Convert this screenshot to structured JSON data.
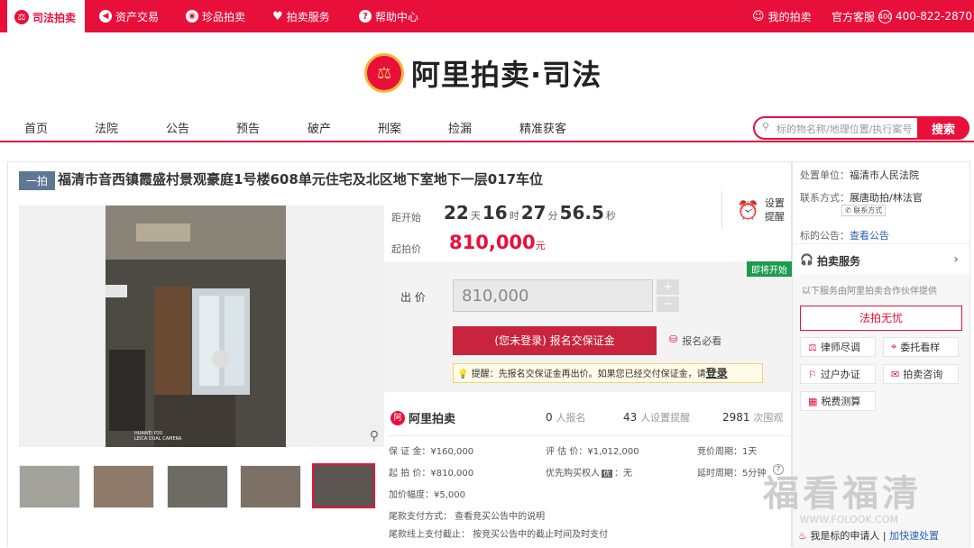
{
  "topbar": {
    "tabs": [
      {
        "label": "司法拍卖",
        "icon": "gavel-icon"
      },
      {
        "label": "资产交易",
        "icon": "asset-icon"
      },
      {
        "label": "珍品拍卖",
        "icon": "treasure-icon"
      },
      {
        "label": "拍卖服务",
        "icon": "heart-icon"
      },
      {
        "label": "帮助中心",
        "icon": "help-icon"
      }
    ],
    "my_auction": "我的拍卖",
    "customer_service": "官方客服",
    "phone": "400-822-2870"
  },
  "brand": {
    "name": "阿里拍卖·司法"
  },
  "nav": {
    "items": [
      "首页",
      "法院",
      "公告",
      "预告",
      "破产",
      "刑案",
      "捡漏",
      "精准获客"
    ]
  },
  "search": {
    "placeholder": "标的物名称/地理位置/执行案号",
    "button": "搜索"
  },
  "item": {
    "round": "一拍",
    "title": "福清市音西镇霞盛村景观豪庭1号楼608单元住宅及北区地下室地下一层017车位",
    "countdown": {
      "label": "距开始",
      "days": "22",
      "days_unit": "天",
      "hours": "16",
      "hours_unit": "时",
      "mins": "27",
      "mins_unit": "分",
      "secs": "56.5",
      "secs_unit": "秒"
    },
    "reminder": "设置提醒",
    "start_price_label": "起拍价",
    "start_price": "810,000",
    "start_price_unit": "元",
    "badge": "即将开始",
    "bid_label": "出 价",
    "bid_value": "810,000",
    "register_button": "(您未登录) 报名交保证金",
    "must_read": "报名必看",
    "tip": "提醒：先报名交保证金再出价。如果您已经交付保证金，请",
    "tip_link": "登录",
    "photo_brand": "HUAWEI P20",
    "photo_camera": "LEICA DUAL CAMERA",
    "stats": {
      "logo": "阿里拍卖",
      "registered": "0",
      "registered_label": "人报名",
      "reminders": "43",
      "reminders_label": "人设置提醒",
      "views": "2981",
      "views_label": "次围观"
    },
    "details": {
      "deposit": "保 证 金：¥160,000",
      "appraisal": "评 估 价：¥1,012,000",
      "period": "竞价周期：1天",
      "start": "起 拍 价：¥810,000",
      "priority": "优先购买权人",
      "priority_value": "：无",
      "delay": "延时周期：5分钟",
      "increment": "加价幅度：¥5,000",
      "payment": "尾款支付方式：  查看竞买公告中的说明",
      "deadline": "尾款线上支付截止：  按竞买公告中的截止时间及时支付"
    }
  },
  "side": {
    "court_label": "处置单位：",
    "court": "福清市人民法院",
    "contact_label": "联系方式：",
    "contact": "展唐助拍/林法官",
    "contact_btn": "联系方式",
    "notice_label": "标的公告：",
    "notice_link": "查看公告",
    "service_title": "拍卖服务",
    "service_desc": "以下服务由阿里拍卖合作伙伴提供",
    "highlight": "法拍无忧",
    "services": [
      "律师尽调",
      "委托看样",
      "过户办证",
      "拍卖咨询",
      "税费测算"
    ],
    "applicant": "我是标的申请人",
    "applicant_link": "加快速处置"
  },
  "watermark": {
    "text": "福看福清",
    "url": "WWW.FOLOOK.COM"
  }
}
